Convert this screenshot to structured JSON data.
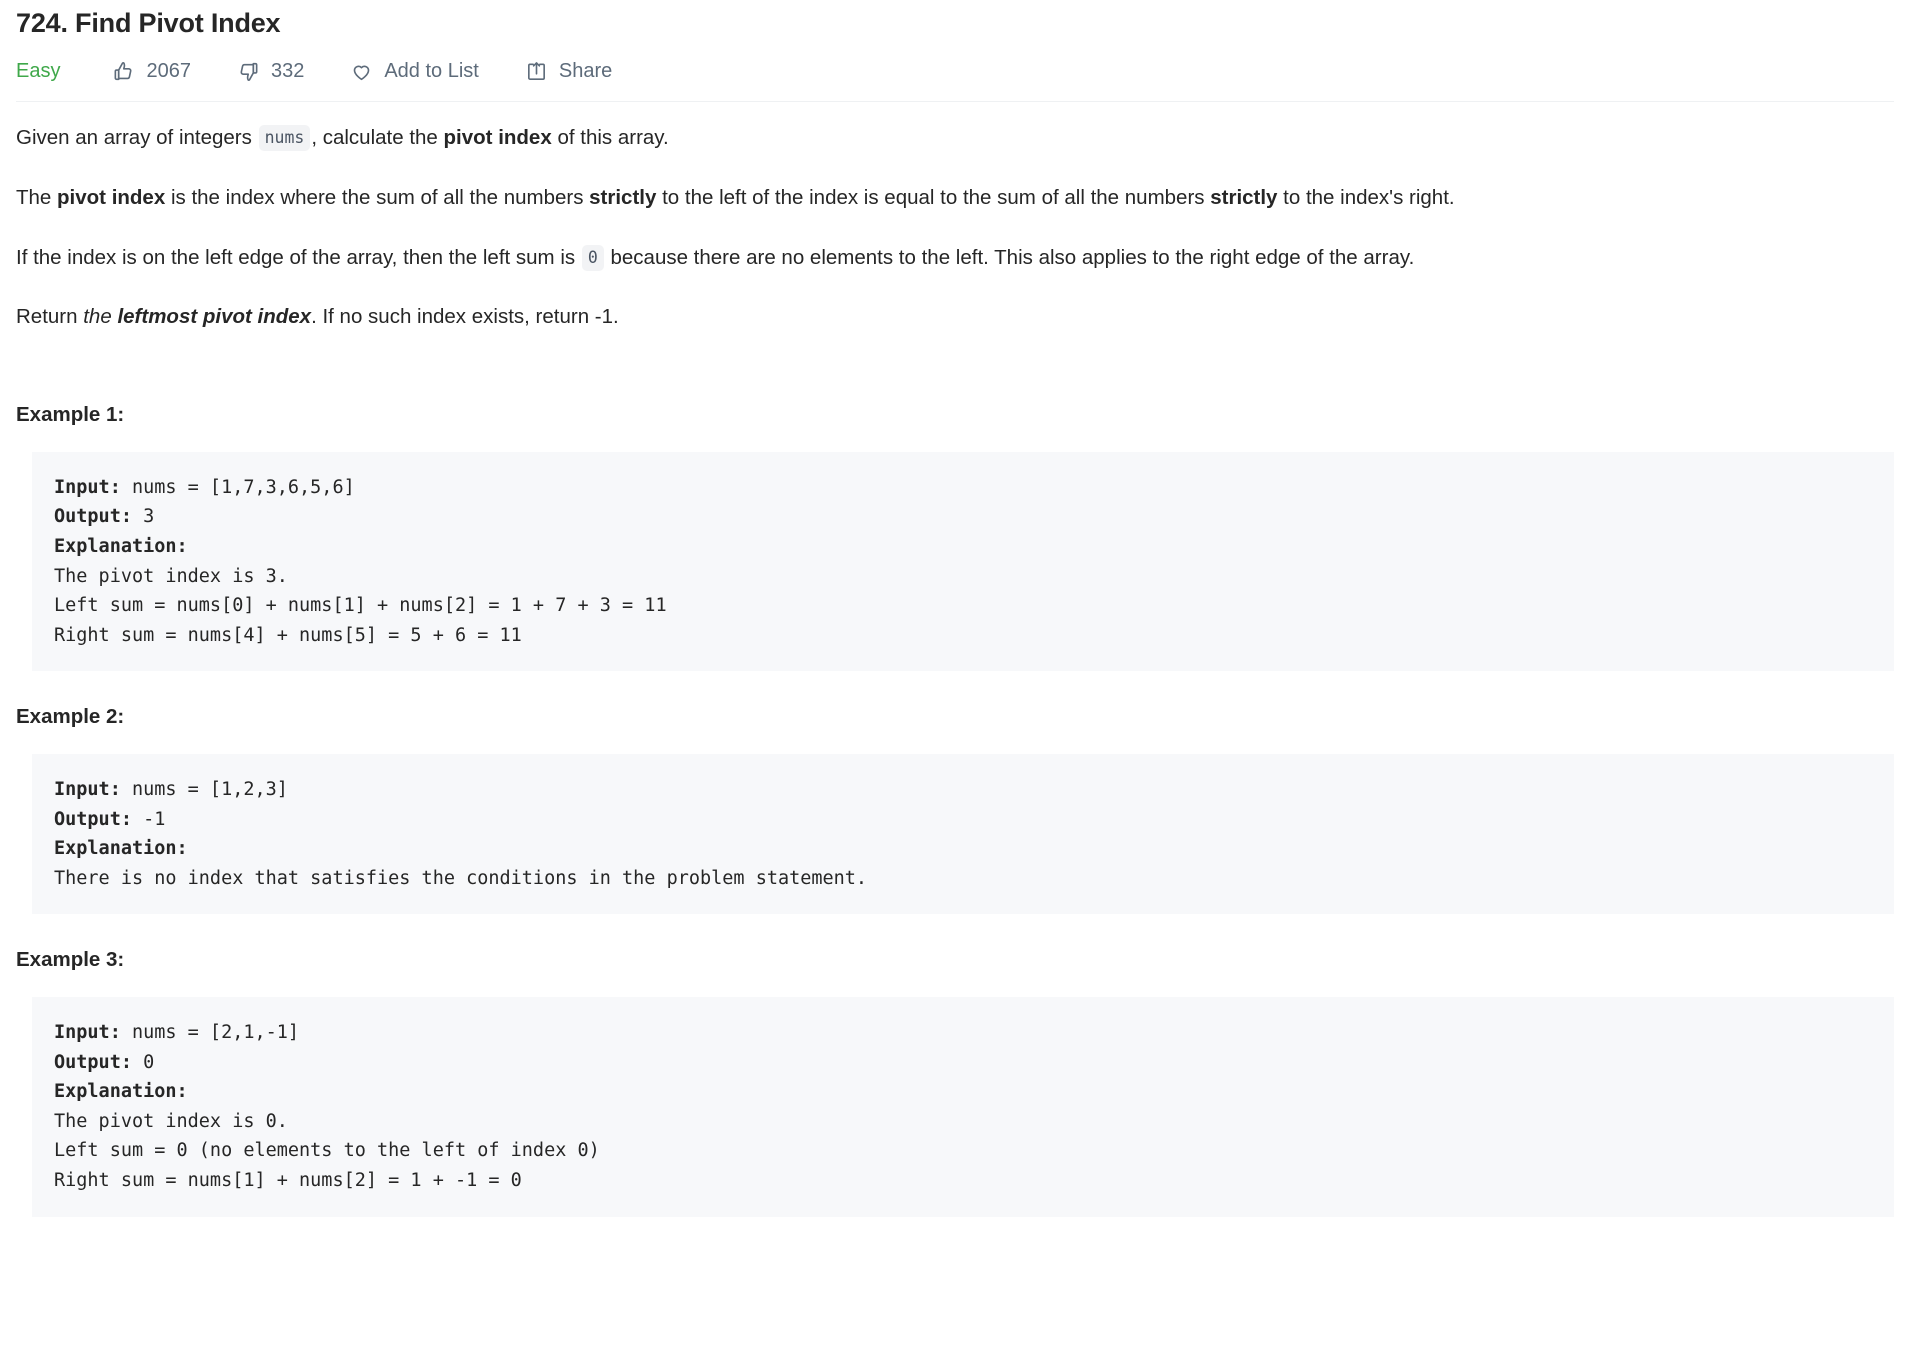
{
  "header": {
    "title": "724. Find Pivot Index",
    "difficulty": "Easy",
    "difficulty_color": "#3fa84a",
    "likes": "2067",
    "dislikes": "332",
    "add_to_list_label": "Add to List",
    "share_label": "Share",
    "icons": {
      "like": "thumbs-up-icon",
      "dislike": "thumbs-down-icon",
      "favorite": "heart-icon",
      "share": "share-icon"
    }
  },
  "description": {
    "p1": {
      "before_code": "Given an array of integers",
      "code": "nums",
      "after_code": ", calculate the",
      "bold": "pivot index",
      "tail": "of this array."
    },
    "p2": {
      "lead": "The",
      "bold1": "pivot index",
      "mid1": "is the index where the sum of all the numbers",
      "bold2": "strictly",
      "mid2": "to the left of the index is equal to the sum of all the numbers",
      "bold3": "strictly",
      "tail": "to the index's right."
    },
    "p3": {
      "before_code": "If the index is on the left edge of the array, then the left sum is",
      "code": "0",
      "after_code": "because there are no elements to the left. This also applies to the right edge of the array."
    },
    "p4": {
      "lead": "Return",
      "italic": "the",
      "bolditalic": "leftmost pivot index",
      "tail": ". If no such index exists, return -1."
    }
  },
  "examples": [
    {
      "title": "Example 1:",
      "input_label": "Input:",
      "input_value": " nums = [1,7,3,6,5,6]",
      "output_label": "Output:",
      "output_value": " 3",
      "explanation_label": "Explanation:",
      "explanation_lines": [
        "The pivot index is 3.",
        "Left sum = nums[0] + nums[1] + nums[2] = 1 + 7 + 3 = 11",
        "Right sum = nums[4] + nums[5] = 5 + 6 = 11"
      ]
    },
    {
      "title": "Example 2:",
      "input_label": "Input:",
      "input_value": " nums = [1,2,3]",
      "output_label": "Output:",
      "output_value": " -1",
      "explanation_label": "Explanation:",
      "explanation_lines": [
        "There is no index that satisfies the conditions in the problem statement."
      ]
    },
    {
      "title": "Example 3:",
      "input_label": "Input:",
      "input_value": " nums = [2,1,-1]",
      "output_label": "Output:",
      "output_value": " 0",
      "explanation_label": "Explanation:",
      "explanation_lines": [
        "The pivot index is 0.",
        "Left sum = 0 (no elements to the left of index 0)",
        "Right sum = nums[1] + nums[2] = 1 + -1 = 0"
      ]
    }
  ]
}
